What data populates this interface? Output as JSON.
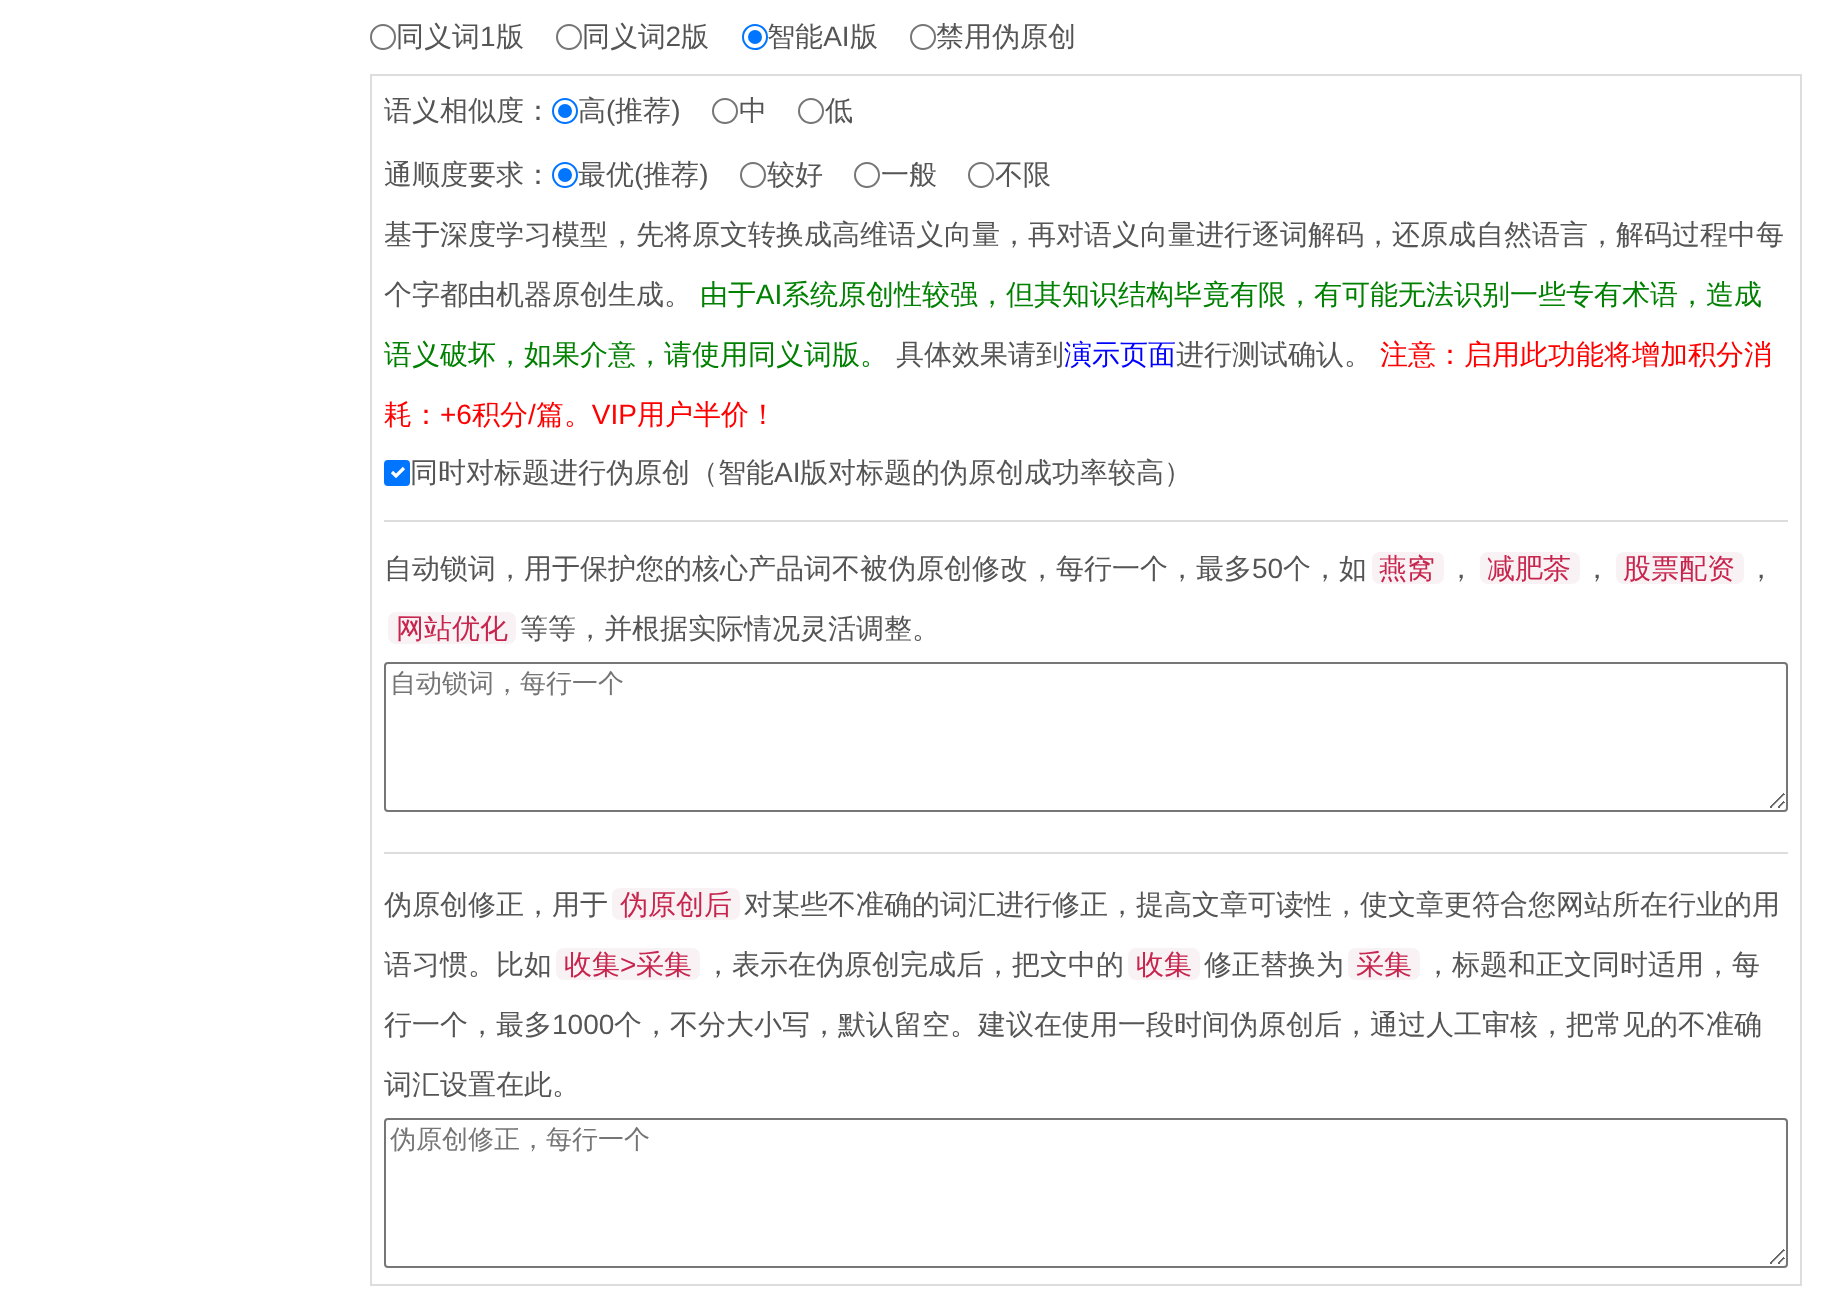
{
  "modes": [
    {
      "label": "同义词1版",
      "selected": false
    },
    {
      "label": "同义词2版",
      "selected": false
    },
    {
      "label": "智能AI版",
      "selected": true
    },
    {
      "label": "禁用伪原创",
      "selected": false
    }
  ],
  "similarity": {
    "label": "语义相似度：",
    "options": [
      {
        "label": "高(推荐)",
        "selected": true
      },
      {
        "label": "中",
        "selected": false
      },
      {
        "label": "低",
        "selected": false
      }
    ]
  },
  "fluency": {
    "label": "通顺度要求：",
    "options": [
      {
        "label": "最优(推荐)",
        "selected": true
      },
      {
        "label": "较好",
        "selected": false
      },
      {
        "label": "一般",
        "selected": false
      },
      {
        "label": "不限",
        "selected": false
      }
    ]
  },
  "description": [
    {
      "kind": "text",
      "text": "基于深度学习模型，先将原文转换成高维语义向量，再对语义向量进行逐词解码，还原成自然语言，解码过程中每个字都由机器原创生成。 "
    },
    {
      "kind": "green",
      "text": "由于AI系统原创性较强，但其知识结构毕竟有限，有可能无法识别一些专有术语，造成语义破坏，如果介意，请使用同义词版。 "
    },
    {
      "kind": "text",
      "text": "具体效果请到"
    },
    {
      "kind": "link",
      "text": "演示页面"
    },
    {
      "kind": "text",
      "text": "进行测试确认。 "
    },
    {
      "kind": "red",
      "text": "注意：启用此功能将增加积分消耗：+6积分/篇。VIP用户半价！"
    }
  ],
  "title_option": {
    "label": "同时对标题进行伪原创（智能AI版对标题的伪原创成功率较高）",
    "checked": true
  },
  "lock_words": {
    "segments": [
      {
        "kind": "text",
        "text": "自动锁词，用于保护您的核心产品词不被伪原创修改，每行一个，最多50个，如"
      },
      {
        "kind": "tag",
        "text": "燕窝"
      },
      {
        "kind": "text",
        "text": "，"
      },
      {
        "kind": "tag",
        "text": "减肥茶"
      },
      {
        "kind": "text",
        "text": "，"
      },
      {
        "kind": "tag",
        "text": "股票配资"
      },
      {
        "kind": "text",
        "text": "，"
      },
      {
        "kind": "tag",
        "text": "网站优化"
      },
      {
        "kind": "text",
        "text": "等等，并根据实际情况灵活调整。"
      }
    ],
    "placeholder": "自动锁词，每行一个"
  },
  "correction": {
    "segments": [
      {
        "kind": "text",
        "text": "伪原创修正，用于"
      },
      {
        "kind": "tag",
        "text": "伪原创后"
      },
      {
        "kind": "text",
        "text": "对某些不准确的词汇进行修正，提高文章可读性，使文章更符合您网站所在行业的用语习惯。比如"
      },
      {
        "kind": "tag",
        "text": "收集>采集"
      },
      {
        "kind": "text",
        "text": "，表示在伪原创完成后，把文中的"
      },
      {
        "kind": "tag",
        "text": "收集"
      },
      {
        "kind": "text",
        "text": "修正替换为"
      },
      {
        "kind": "tag",
        "text": "采集"
      },
      {
        "kind": "text",
        "text": "，标题和正文同时适用，每行一个，最多1000个，不分大小写，默认留空。建议在使用一段时间伪原创后，通过人工审核，把常见的不准确词汇设置在此。"
      }
    ],
    "placeholder": "伪原创修正，每行一个"
  }
}
